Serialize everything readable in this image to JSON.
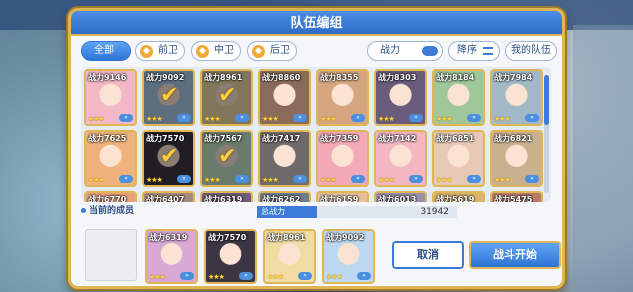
{
  "dialog": {
    "title": "队伍编组"
  },
  "tabs": [
    {
      "label": "全部",
      "icon": "",
      "active": true
    },
    {
      "label": "前卫",
      "icon": "shield-icon"
    },
    {
      "label": "中卫",
      "icon": "sword-icon"
    },
    {
      "label": "后卫",
      "icon": "staff-icon"
    }
  ],
  "sort": {
    "label": "战力",
    "order_label": "降序",
    "my_team_label": "我的队伍"
  },
  "roster": [
    {
      "power": "战力9146",
      "stars": "★★★",
      "selected": false,
      "color": "#f2b8c6"
    },
    {
      "power": "战力9092",
      "stars": "★★★",
      "selected": true,
      "color": "#a9c8e6"
    },
    {
      "power": "战力8961",
      "stars": "★★★",
      "selected": true,
      "color": "#e9d9a6"
    },
    {
      "power": "战力8860",
      "stars": "★★★",
      "selected": false,
      "color": "#8a6b5a"
    },
    {
      "power": "战力8355",
      "stars": "★★★",
      "selected": false,
      "color": "#d4a57f"
    },
    {
      "power": "战力8303",
      "stars": "★★★",
      "selected": false,
      "color": "#6b5b7a"
    },
    {
      "power": "战力8184",
      "stars": "★★★",
      "selected": false,
      "color": "#9fc79a"
    },
    {
      "power": "战力7984",
      "stars": "★★★",
      "selected": false,
      "color": "#a0b9c7"
    },
    {
      "power": "战力7625",
      "stars": "★★★",
      "selected": false,
      "color": "#f0b27a"
    },
    {
      "power": "战力7570",
      "stars": "★★★",
      "selected": true,
      "color": "#3c3542"
    },
    {
      "power": "战力7567",
      "stars": "★★★",
      "selected": true,
      "color": "#bfe0c5"
    },
    {
      "power": "战力7417",
      "stars": "★★★",
      "selected": false,
      "color": "#6e6a68"
    },
    {
      "power": "战力7359",
      "stars": "★★★",
      "selected": false,
      "color": "#f3a9b6"
    },
    {
      "power": "战力7142",
      "stars": "★★★",
      "selected": false,
      "color": "#f4b6c3"
    },
    {
      "power": "战力6851",
      "stars": "★★★",
      "selected": false,
      "color": "#e7c9b6"
    },
    {
      "power": "战力6821",
      "stars": "★★★",
      "selected": false,
      "color": "#c9b18f"
    },
    {
      "power": "战力6770",
      "stars": "★★★",
      "selected": false,
      "color": "#e8a07a"
    },
    {
      "power": "战力6407",
      "stars": "★★★",
      "selected": false,
      "color": "#a88b7a"
    },
    {
      "power": "战力6319",
      "stars": "★★★",
      "selected": true,
      "color": "#c9a6d4"
    },
    {
      "power": "战力6262",
      "stars": "★★★",
      "selected": false,
      "color": "#6d7b8f"
    },
    {
      "power": "战力6159",
      "stars": "★★★",
      "selected": false,
      "color": "#e9bfa0"
    },
    {
      "power": "战力6013",
      "stars": "★★★",
      "selected": false,
      "color": "#9a8fa8"
    },
    {
      "power": "战力5619",
      "stars": "★★★",
      "selected": false,
      "color": "#d9b46a"
    },
    {
      "power": "战力5475",
      "stars": "★★★",
      "selected": false,
      "color": "#b97b6a"
    }
  ],
  "party": {
    "label": "当前的成员",
    "total_label": "总战力",
    "total_value": "31942",
    "members": [
      {
        "power": "战力6319",
        "stars": "★★★",
        "color": "#d9a8d4"
      },
      {
        "power": "战力7570",
        "stars": "★★★",
        "color": "#3c3542"
      },
      {
        "power": "战力8961",
        "stars": "★★★",
        "color": "#f0dca2"
      },
      {
        "power": "战力9092",
        "stars": "★★★",
        "color": "#bcd9ef"
      }
    ]
  },
  "buttons": {
    "cancel": "取消",
    "start": "战斗开始"
  }
}
